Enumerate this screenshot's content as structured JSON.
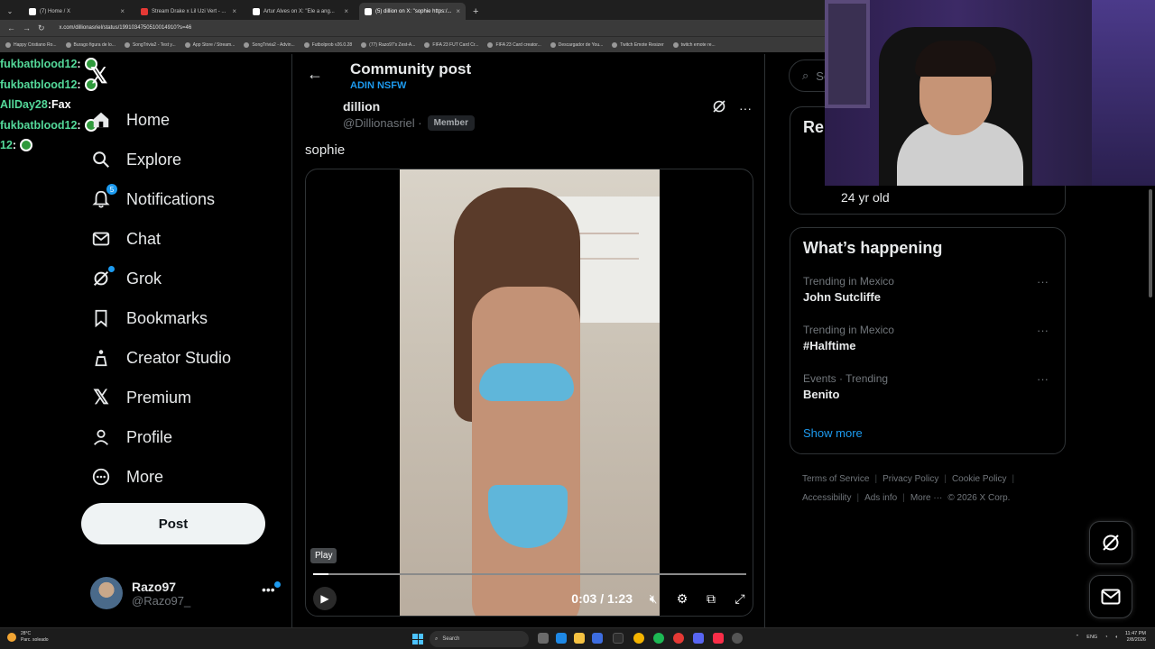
{
  "browser": {
    "tabs": [
      {
        "title": "(7) Home / X",
        "favicon": "x-icon",
        "active": false
      },
      {
        "title": "Stream Drake x Lil Uzi Vert - ...",
        "favicon": "youtube-icon",
        "active": false
      },
      {
        "title": "Artur Alves on X: \"Ele a ang...",
        "favicon": "x-icon",
        "active": false
      },
      {
        "title": "(5) dillion on X: \"sophie https:/...",
        "favicon": "x-icon",
        "active": true
      }
    ],
    "url": "x.com/dillionasriel/status/1991034750510014910?s=46",
    "bookmarks": [
      "Happy Cristiano Ro...",
      "Burago figura de lo...",
      "SongTrivia2 - Test y...",
      "App Store / Stream...",
      "SongTrivia2 - Advin...",
      "Futbolprob v26.0.28",
      "(77) Razo97's Zest-A...",
      "FIFA 23 FUT Card Cr...",
      "FIFA 23 Card creator...",
      "Descargador de You...",
      "Twitch Emote Resizer",
      "twitch emote re..."
    ]
  },
  "chat": [
    {
      "user": "fukbatblood12",
      "sep": " :",
      "msg": ""
    },
    {
      "user": "fukbatblood12",
      "sep": " :",
      "msg": ""
    },
    {
      "user": "AllDay28",
      "sep": " : ",
      "msg": "Fax"
    },
    {
      "user": "fukbatblood12",
      "sep": " :",
      "msg": ""
    },
    {
      "user": "12",
      "sep": " :",
      "msg": ""
    }
  ],
  "nav": {
    "items": [
      {
        "label": "Home",
        "icon": "home-icon"
      },
      {
        "label": "Explore",
        "icon": "search-icon"
      },
      {
        "label": "Notifications",
        "icon": "bell-icon",
        "badge": "5"
      },
      {
        "label": "Chat",
        "icon": "mail-icon"
      },
      {
        "label": "Grok",
        "icon": "grok-icon"
      },
      {
        "label": "Bookmarks",
        "icon": "bookmark-icon"
      },
      {
        "label": "Creator Studio",
        "icon": "creator-icon"
      },
      {
        "label": "Premium",
        "icon": "x-icon"
      },
      {
        "label": "Profile",
        "icon": "person-icon"
      },
      {
        "label": "More",
        "icon": "more-circle-icon"
      }
    ],
    "post_label": "Post",
    "account": {
      "name": "Razo97",
      "handle": "@Razo97_"
    }
  },
  "post": {
    "community_title": "Community post",
    "community_name": "ADIN NSFW",
    "author_name": "dillion",
    "author_handle": "@Dillionasriel ·",
    "member_badge": "Member",
    "text": "sophie",
    "video": {
      "tooltip": "Play",
      "time": "0:03 / 1:23",
      "progress": 0.036
    }
  },
  "right": {
    "search_placeholder": "Se",
    "relevant_title": "Rel",
    "relevant_bio": "24 yr old",
    "happening_title": "What’s happening",
    "trends": [
      {
        "context": "Trending in Mexico",
        "name": "John Sutcliffe"
      },
      {
        "context": "Trending in Mexico",
        "name": "#Halftime"
      },
      {
        "context": "Events · Trending",
        "name": "Benito"
      }
    ],
    "show_more": "Show more",
    "footer": [
      "Terms of Service",
      "Privacy Policy",
      "Cookie Policy",
      "Accessibility",
      "Ads info",
      "More ···",
      "© 2026 X Corp."
    ]
  },
  "taskbar": {
    "weather_temp": "28°C",
    "weather_desc": "Parc. soleado",
    "search_label": "Search",
    "lang": "ENG",
    "time": "11:47 PM",
    "date": "2/8/2026"
  },
  "colors": {
    "accent": "#1d9bf0",
    "background": "#000000",
    "border": "#2f3336",
    "chat_user": "#54d99a"
  }
}
